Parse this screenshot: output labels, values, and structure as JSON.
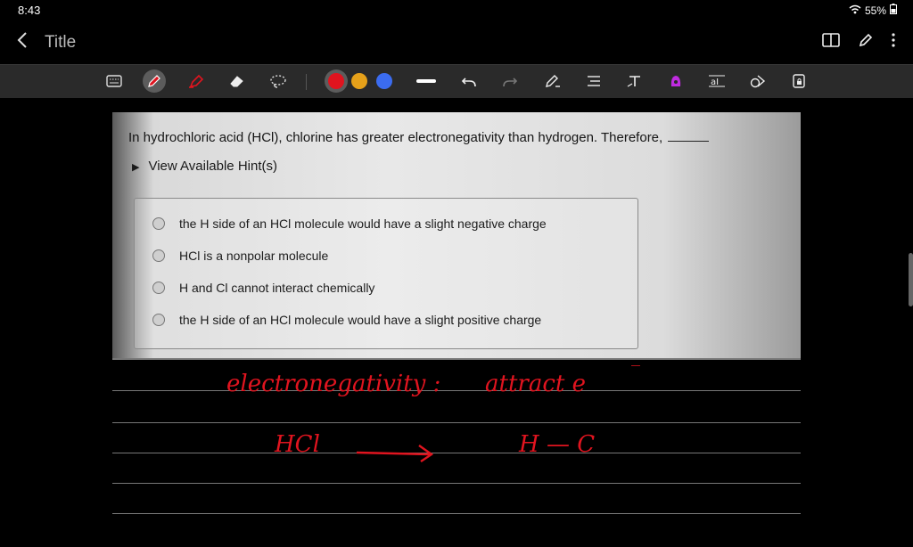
{
  "status": {
    "time": "8:43",
    "battery": "55%"
  },
  "title": "Title",
  "question": {
    "prompt": "In hydrochloric acid (HCl), chlorine has greater electronegativity than hydrogen. Therefore,",
    "hint": "View Available Hint(s)",
    "options": [
      "the H side of an HCl molecule would have a slight negative charge",
      "HCl is a nonpolar molecule",
      "H and Cl cannot interact chemically",
      "the H side of an HCl molecule would have a slight positive charge"
    ]
  },
  "notes": {
    "line1_left": "electronegativity :",
    "line1_right": "attract e",
    "line2_left": "HCl",
    "line2_right": "H — C"
  },
  "colors": {
    "red": "#e0141f",
    "yellow": "#e6a11a",
    "blue": "#3b6cf0",
    "ink": "#e0141f"
  }
}
